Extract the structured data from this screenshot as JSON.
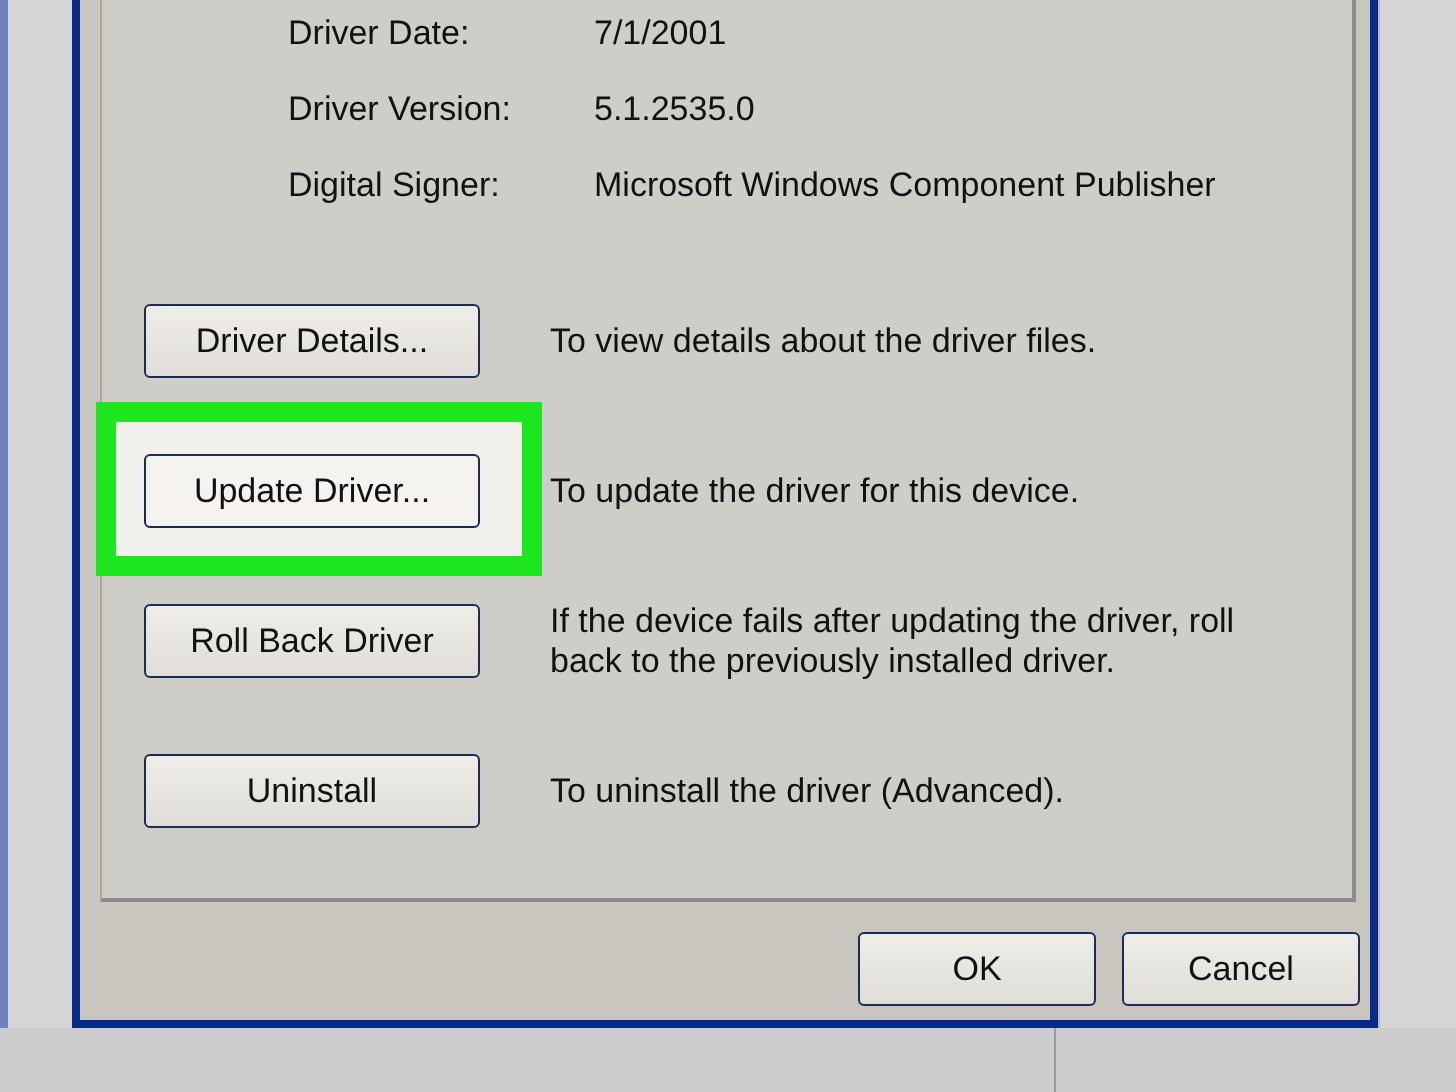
{
  "driver_info": [
    {
      "label": "Driver Date:",
      "value": "7/1/2001"
    },
    {
      "label": "Driver Version:",
      "value": "5.1.2535.0"
    },
    {
      "label": "Digital Signer:",
      "value": "Microsoft Windows Component Publisher"
    }
  ],
  "actions": [
    {
      "button": "Driver Details...",
      "description": "To view details about the driver files.",
      "highlighted": false
    },
    {
      "button": "Update Driver...",
      "description": "To update the driver for this device.",
      "highlighted": true
    },
    {
      "button": "Roll Back Driver",
      "description": "If the device fails after updating the driver, roll back to the previously installed driver.",
      "highlighted": false
    },
    {
      "button": "Uninstall",
      "description": "To uninstall the driver (Advanced).",
      "highlighted": false
    }
  ],
  "dialog_buttons": [
    "OK",
    "Cancel"
  ]
}
